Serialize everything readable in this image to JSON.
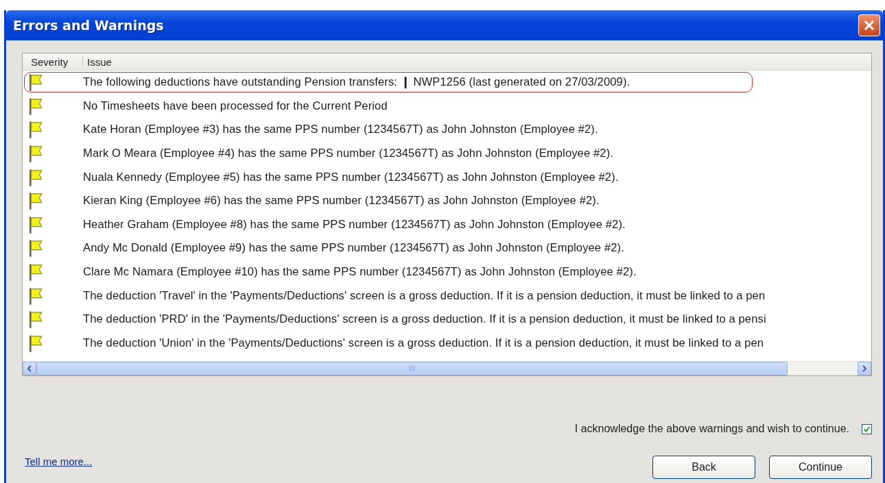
{
  "window": {
    "title": "Errors and Warnings"
  },
  "table": {
    "columns": [
      "Severity",
      "Issue"
    ],
    "rows": [
      {
        "kind": "warning",
        "highlighted": true,
        "issue": "The following deductions have outstanding Pension transfers: ❙ NWP1256 (last generated on 27/03/2009)."
      },
      {
        "kind": "warning",
        "highlighted": false,
        "issue": "No Timesheets have been processed for the Current Period"
      },
      {
        "kind": "warning",
        "highlighted": false,
        "issue": "Kate Horan (Employee #3) has the same PPS number (1234567T) as John Johnston (Employee #2)."
      },
      {
        "kind": "warning",
        "highlighted": false,
        "issue": "Mark O Meara (Employee #4) has the same PPS number (1234567T) as John Johnston (Employee #2)."
      },
      {
        "kind": "warning",
        "highlighted": false,
        "issue": "Nuala Kennedy (Employee #5) has the same PPS number (1234567T) as John Johnston (Employee #2)."
      },
      {
        "kind": "warning",
        "highlighted": false,
        "issue": "Kieran King (Employee #6) has the same PPS number (1234567T) as John Johnston (Employee #2)."
      },
      {
        "kind": "warning",
        "highlighted": false,
        "issue": "Heather Graham (Employee #8) has the same PPS number (1234567T) as John Johnston (Employee #2)."
      },
      {
        "kind": "warning",
        "highlighted": false,
        "issue": "Andy Mc Donald (Employee #9) has the same PPS number (1234567T) as John Johnston (Employee #2)."
      },
      {
        "kind": "warning",
        "highlighted": false,
        "issue": "Clare Mc Namara (Employee #10) has the same PPS number (1234567T) as John Johnston (Employee #2)."
      },
      {
        "kind": "warning",
        "highlighted": false,
        "issue": "The deduction 'Travel' in the 'Payments/Deductions' screen is a gross deduction. If it is a pension deduction, it must be linked to a pen"
      },
      {
        "kind": "warning",
        "highlighted": false,
        "issue": "The deduction 'PRD' in the 'Payments/Deductions' screen is a gross deduction. If it is a pension deduction, it must be linked to a pensi"
      },
      {
        "kind": "warning",
        "highlighted": false,
        "issue": "The deduction 'Union' in the 'Payments/Deductions' screen is a gross deduction. If it is a pension deduction, it must be linked to a pen"
      }
    ]
  },
  "acknowledge": {
    "label": "I acknowledge the above warnings and wish to continue.",
    "checked": true
  },
  "link": "Tell me more...",
  "buttons": [
    "Back",
    "Continue"
  ]
}
